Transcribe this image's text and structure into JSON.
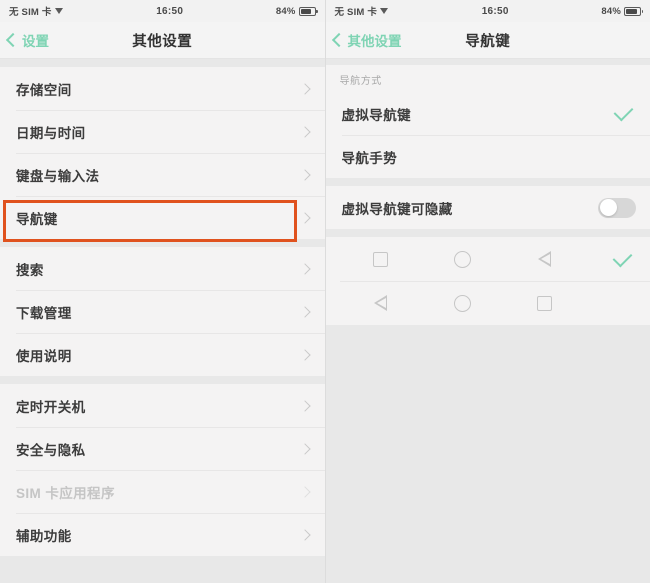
{
  "status_bar": {
    "carrier": "无 SIM 卡",
    "wifi_icon": "wifi-icon",
    "time": "16:50",
    "battery_percent": "84%",
    "battery_level": 84,
    "battery_icon": "battery-icon"
  },
  "colors": {
    "accent_green": "#7fd4b4",
    "highlight_orange": "#e0521e",
    "background_gray": "#e8e8e8",
    "card_white": "#f4f3f3",
    "text_primary": "#3c3c3c",
    "text_disabled": "#c5c5c5"
  },
  "left_panel": {
    "back_label": "设置",
    "title": "其他设置",
    "groups": [
      {
        "items": [
          {
            "label": "存储空间",
            "disabled": false,
            "highlighted": false
          },
          {
            "label": "日期与时间",
            "disabled": false,
            "highlighted": false
          },
          {
            "label": "键盘与输入法",
            "disabled": false,
            "highlighted": false
          },
          {
            "label": "导航键",
            "disabled": false,
            "highlighted": true
          }
        ]
      },
      {
        "items": [
          {
            "label": "搜索",
            "disabled": false,
            "highlighted": false
          },
          {
            "label": "下载管理",
            "disabled": false,
            "highlighted": false
          },
          {
            "label": "使用说明",
            "disabled": false,
            "highlighted": false
          }
        ]
      },
      {
        "items": [
          {
            "label": "定时开关机",
            "disabled": false,
            "highlighted": false
          },
          {
            "label": "安全与隐私",
            "disabled": false,
            "highlighted": false
          },
          {
            "label": "SIM 卡应用程序",
            "disabled": true,
            "highlighted": false
          },
          {
            "label": "辅助功能",
            "disabled": false,
            "highlighted": false
          }
        ]
      }
    ]
  },
  "right_panel": {
    "back_label": "其他设置",
    "title": "导航键",
    "section_header": "导航方式",
    "mode_items": [
      {
        "label": "虚拟导航键",
        "checked": true
      },
      {
        "label": "导航手势",
        "checked": false
      }
    ],
    "toggle_row": {
      "label": "虚拟导航键可隐藏",
      "state": "off"
    },
    "layout_rows": [
      {
        "keys": [
          "square",
          "circle",
          "triangle"
        ],
        "checked": true
      },
      {
        "keys": [
          "triangle",
          "circle",
          "square"
        ],
        "checked": false
      }
    ]
  }
}
